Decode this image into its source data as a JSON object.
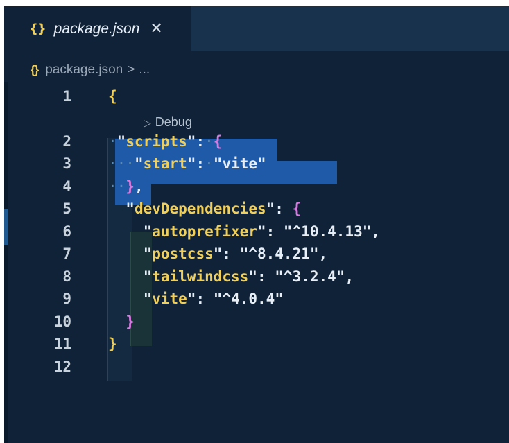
{
  "tab": {
    "icon": "{}",
    "name": "package.json",
    "close_glyph": "✕"
  },
  "breadcrumb": {
    "icon": "{}",
    "file": "package.json",
    "separator": ">",
    "ellipsis": "..."
  },
  "codelens": {
    "label": "Debug",
    "icon": "debug-run-icon"
  },
  "lines": [
    {
      "number": "1"
    },
    {
      "number": "2"
    },
    {
      "number": "3"
    },
    {
      "number": "4"
    },
    {
      "number": "5"
    },
    {
      "number": "6"
    },
    {
      "number": "7"
    },
    {
      "number": "8"
    },
    {
      "number": "9"
    },
    {
      "number": "10"
    },
    {
      "number": "11"
    },
    {
      "number": "12"
    }
  ],
  "code": {
    "open_brace": "{",
    "close_brace": "}",
    "scripts_key": "scripts",
    "start_key": "start",
    "start_value": "vite",
    "devdeps_key": "devDependencies",
    "deps": [
      {
        "name": "autoprefixer",
        "version": "^10.4.13",
        "comma": ","
      },
      {
        "name": "postcss",
        "version": "^8.4.21",
        "comma": ","
      },
      {
        "name": "tailwindcss",
        "version": "^3.2.4",
        "comma": ","
      },
      {
        "name": "vite",
        "version": "^4.0.4",
        "comma": ""
      }
    ]
  },
  "colors": {
    "editor_bg": "#0f2238",
    "selection": "#1e5aa8",
    "key_yellow": "#f0cf5b",
    "brace_purple": "#d77be0",
    "brace_blue": "#4aa3ff"
  }
}
